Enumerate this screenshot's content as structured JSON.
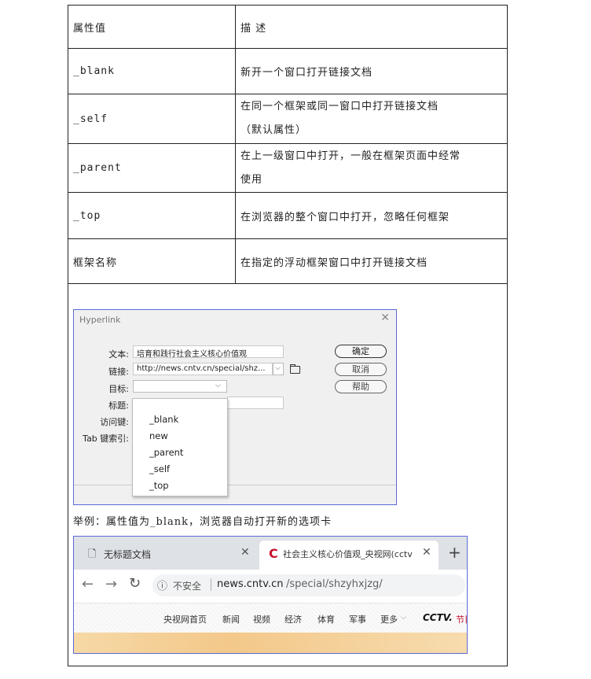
{
  "table": {
    "header": {
      "col1": "属性值",
      "col2": "描 述"
    },
    "rows": [
      {
        "value": "_blank",
        "desc_line1": "新开一个窗口打开链接文档",
        "desc_line2": ""
      },
      {
        "value": "_self",
        "desc_line1": "在同一个框架或同一窗口中打开链接文档",
        "desc_line2": "（默认属性）"
      },
      {
        "value": "_parent",
        "desc_line1": "在上一级窗口中打开，一般在框架页面中经常",
        "desc_line2": "使用"
      },
      {
        "value": "_top",
        "desc_line1": "在浏览器的整个窗口中打开，忽略任何框架",
        "desc_line2": ""
      },
      {
        "value": "框架名称",
        "desc_line1": "在指定的浮动框架窗口中打开链接文档",
        "desc_line2": ""
      }
    ]
  },
  "dialog": {
    "title": "Hyperlink",
    "labels": {
      "text": "文本:",
      "link": "链接:",
      "target": "目标:",
      "caption": "标题:",
      "accesskey": "访问键:",
      "tabindex": "Tab 键索引:"
    },
    "text_value": "培育和践行社会主义核心价值观",
    "link_value": "http://news.cntv.cn/special/shz...",
    "buttons": {
      "ok": "确定",
      "cancel": "取消",
      "help": "帮助"
    },
    "dropdown_options": [
      "_blank",
      "new",
      "_parent",
      "_self",
      "_top"
    ]
  },
  "caption": "举例：属性值为_blank，浏览器自动打开新的选项卡",
  "browser": {
    "tab1_title": "无标题文档",
    "tab2_title": "社会主义核心价值观_央视网(cctv",
    "security": "不安全",
    "url_domain": "news.cntv.cn",
    "url_path": "/special/shzyhxjzg/",
    "nav_items": [
      "央视网首页",
      "新闻",
      "视频",
      "经济",
      "体育",
      "军事",
      "更多"
    ],
    "logo_text": "CCTV.",
    "logo_suffix": "节目"
  },
  "colors": {
    "dialog_border": "#5b6bd6",
    "cctv_red": "#c8102e",
    "url_gray": "#5f6368"
  }
}
